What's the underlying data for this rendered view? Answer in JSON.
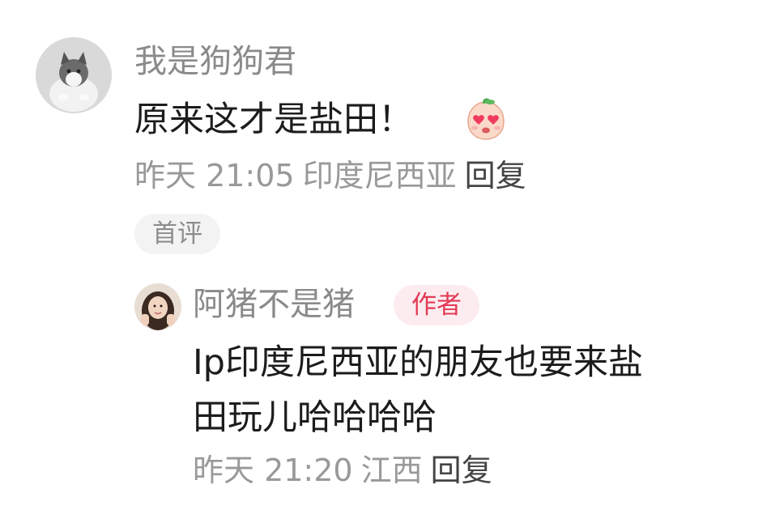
{
  "comment": {
    "username": "我是狗狗君",
    "content": "原来这才是盐田！",
    "emoji_icon": "heart-eyes-peach-emoji",
    "time": "昨天 21:05",
    "location": "印度尼西亚",
    "reply_label": "回复",
    "badge": "首评"
  },
  "reply": {
    "username": "阿猪不是猪",
    "badge": "作者",
    "content_line1": "Ip印度尼西亚的朋友也要来盐",
    "content_line2": "田玩儿哈哈哈哈",
    "time": "昨天 21:20",
    "location": "江西",
    "reply_label": "回复"
  },
  "colors": {
    "username": "#8a8a8a",
    "content": "#1c1c1c",
    "meta": "#999999",
    "reply_action": "#444444",
    "author_badge_text": "#e23a55",
    "author_badge_bg": "#fdecef",
    "first_badge_bg": "#f3f3f3"
  }
}
